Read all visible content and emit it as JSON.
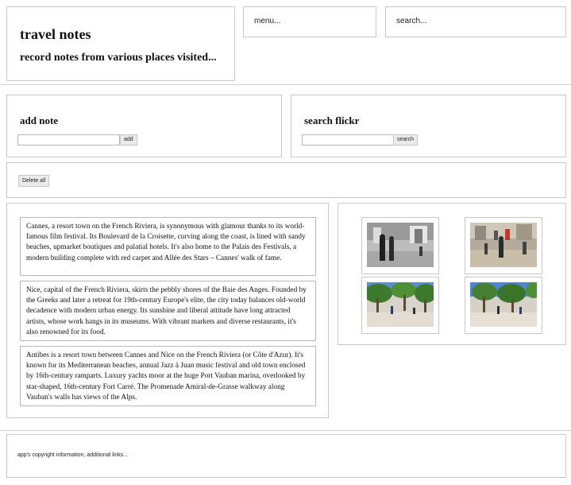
{
  "header": {
    "title": "travel notes",
    "subtitle": "record notes from various places visited..."
  },
  "nav": {
    "menu_label": "menu...",
    "search_label": "search..."
  },
  "add_note": {
    "title": "add note",
    "input_value": "",
    "button_label": "add"
  },
  "search_flickr": {
    "title": "search flickr",
    "input_value": "",
    "button_label": "search"
  },
  "actions": {
    "delete_all_label": "Delete all"
  },
  "notes": [
    {
      "text": "Cannes, a resort town on the French Riviera, is synonymous with glamour thanks to its world-famous film festival. Its Boulevard de la Croisette, curving along the coast, is lined with sandy beaches, upmarket boutiques and palatial hotels. It's also home to the Palais des Festivals, a modern building complete with red carpet and Allée des Stars – Cannes' walk of fame."
    },
    {
      "text": "Nice, capital of the French Riviera, skirts the pebbly shores of the Baie des Anges. Founded by the Greeks and later a retreat for 19th-century Europe's elite, the city today balances old-world decadence with modern urban energy. Its sunshine and liberal attitude have long attracted artists, whose work hangs in its museums. With vibrant markets and diverse restaurants, it's also renowned for its food."
    },
    {
      "text": "Antibes is a resort town between Cannes and Nice on the French Riviera (or Côte d'Azur). It's known for its Mediterranean beaches, annual Jazz à Juan music festival and old town enclosed by 16th-century ramparts. Luxury yachts moor at the huge Port Vauban marina, overlooked by star-shaped, 16th-century Fort Carré. The Promenade Amiral-de-Grasse walkway along Vauban's walls has views of the Alps."
    }
  ],
  "photos": [
    {
      "icon": "photo-petanque-bw"
    },
    {
      "icon": "photo-petanque-plaza"
    },
    {
      "icon": "photo-park-trees-1"
    },
    {
      "icon": "photo-park-trees-2"
    }
  ],
  "footer": {
    "text": "app's copyright information, additional links..."
  },
  "colors": {
    "border": "#c9c9c9",
    "button_bg": "#eaeaea",
    "text": "#111111"
  }
}
